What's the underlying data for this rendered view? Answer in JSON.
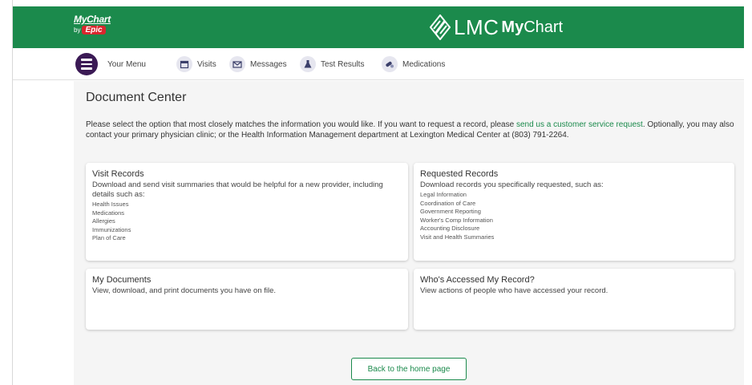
{
  "header": {
    "mychart_logo_line1": "MyChart",
    "mychart_logo_by": "by",
    "mychart_logo_epic": "Epic",
    "brand_lmc": "LMC",
    "brand_my": "My",
    "brand_chart": "Chart",
    "colors": {
      "header_bg": "#1b8a4c",
      "menu_button": "#3b1a55",
      "epic_badge": "#d9272e"
    }
  },
  "nav": {
    "menu_label": "Your Menu",
    "items": [
      {
        "label": "Visits",
        "icon": "calendar-icon"
      },
      {
        "label": "Messages",
        "icon": "envelope-icon"
      },
      {
        "label": "Test Results",
        "icon": "flask-icon"
      },
      {
        "label": "Medications",
        "icon": "pills-icon"
      }
    ]
  },
  "page": {
    "title": "Document Center",
    "intro_part1": "Please select the option that most closely matches the information you would like. If you want to request a record, please ",
    "intro_link": "send us a customer service request",
    "intro_part2": ". Optionally, you may also contact your primary physician clinic; or the Health Information Management department at Lexington Medical Center at (803) 791-2264."
  },
  "cards": {
    "visit_records": {
      "title": "Visit Records",
      "desc": "Download and send visit summaries that would be helpful for a new provider, including details such as:",
      "items": [
        "Health Issues",
        "Medications",
        "Allergies",
        "Immunizations",
        "Plan of Care"
      ]
    },
    "requested_records": {
      "title": "Requested Records",
      "desc": "Download records you specifically requested, such as:",
      "items": [
        "Legal Information",
        "Coordination of Care",
        "Government Reporting",
        "Worker's Comp Information",
        "Accounting Disclosure",
        "Visit and Health Summaries"
      ]
    },
    "my_documents": {
      "title": "My Documents",
      "desc": "View, download, and print documents you have on file."
    },
    "whos_accessed": {
      "title": "Who's Accessed My Record?",
      "desc": "View actions of people who have accessed your record."
    }
  },
  "footer": {
    "back_label": "Back to the home page"
  }
}
